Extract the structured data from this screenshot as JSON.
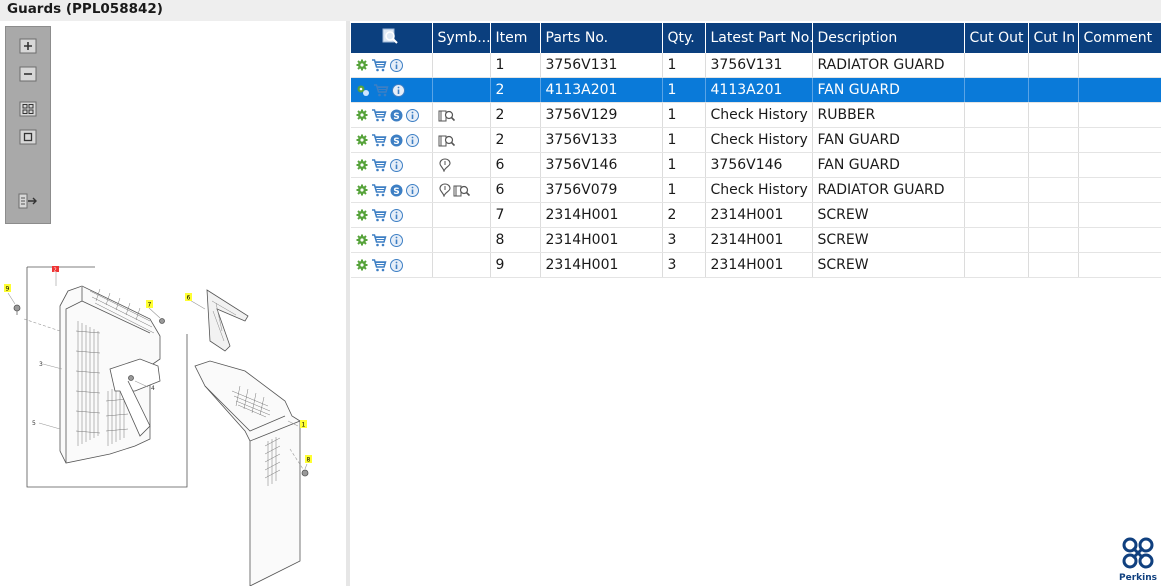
{
  "window": {
    "title": "Guards (PPL058842)"
  },
  "toolbar": {
    "buttons": [
      {
        "name": "zoom-in-button",
        "icon": "zoom-in-icon"
      },
      {
        "name": "zoom-out-button",
        "icon": "zoom-out-icon"
      },
      {
        "name": "fit-window-button",
        "icon": "fit-window-icon"
      },
      {
        "name": "actual-size-button",
        "icon": "actual-size-icon"
      },
      {
        "name": "export-button",
        "icon": "export-icon"
      }
    ]
  },
  "drawing": {
    "callouts": [
      "9",
      "7",
      "6",
      "3",
      "4",
      "5",
      "1",
      "8",
      "2"
    ]
  },
  "table": {
    "columns": [
      "",
      "Symb...",
      "Item",
      "Parts No.",
      "Qty.",
      "Latest Part No.",
      "Description",
      "Cut Out",
      "Cut In",
      "Comment"
    ],
    "rows": [
      {
        "item": "1",
        "part_no": "3756V131",
        "qty": "1",
        "latest": "3756V131",
        "description": "RADIATOR GUARD",
        "cut_out": "",
        "cut_in": "",
        "comment": "",
        "icons": [
          "gear-icon",
          "cart-icon",
          "info-icon"
        ],
        "symbols": [],
        "selected": false
      },
      {
        "item": "2",
        "part_no": "4113A201",
        "qty": "1",
        "latest": "4113A201",
        "description": "FAN GUARD",
        "cut_out": "",
        "cut_in": "",
        "comment": "",
        "icons": [
          "gear-icon",
          "cart-icon",
          "info-icon"
        ],
        "symbols": [],
        "selected": true
      },
      {
        "item": "2",
        "part_no": "3756V129",
        "qty": "1",
        "latest": "Check History",
        "description": "RUBBER",
        "cut_out": "",
        "cut_in": "",
        "comment": "",
        "icons": [
          "gear-icon",
          "cart-icon",
          "s-badge-icon",
          "info-icon"
        ],
        "symbols": [
          "history-icon"
        ],
        "selected": false
      },
      {
        "item": "2",
        "part_no": "3756V133",
        "qty": "1",
        "latest": "Check History",
        "description": "FAN GUARD",
        "cut_out": "",
        "cut_in": "",
        "comment": "",
        "icons": [
          "gear-icon",
          "cart-icon",
          "s-badge-icon",
          "info-icon"
        ],
        "symbols": [
          "history-icon"
        ],
        "selected": false
      },
      {
        "item": "6",
        "part_no": "3756V146",
        "qty": "1",
        "latest": "3756V146",
        "description": "FAN GUARD",
        "cut_out": "",
        "cut_in": "",
        "comment": "",
        "icons": [
          "gear-icon",
          "cart-icon",
          "info-icon"
        ],
        "symbols": [
          "pin-icon"
        ],
        "selected": false
      },
      {
        "item": "6",
        "part_no": "3756V079",
        "qty": "1",
        "latest": "Check History",
        "description": "RADIATOR GUARD",
        "cut_out": "",
        "cut_in": "",
        "comment": "",
        "icons": [
          "gear-icon",
          "cart-icon",
          "s-badge-icon",
          "info-icon"
        ],
        "symbols": [
          "pin-icon",
          "history-icon"
        ],
        "selected": false
      },
      {
        "item": "7",
        "part_no": "2314H001",
        "qty": "2",
        "latest": "2314H001",
        "description": "SCREW",
        "cut_out": "",
        "cut_in": "",
        "comment": "",
        "icons": [
          "gear-icon",
          "cart-icon",
          "info-icon"
        ],
        "symbols": [],
        "selected": false
      },
      {
        "item": "8",
        "part_no": "2314H001",
        "qty": "3",
        "latest": "2314H001",
        "description": "SCREW",
        "cut_out": "",
        "cut_in": "",
        "comment": "",
        "icons": [
          "gear-icon",
          "cart-icon",
          "info-icon"
        ],
        "symbols": [],
        "selected": false
      },
      {
        "item": "9",
        "part_no": "2314H001",
        "qty": "3",
        "latest": "2314H001",
        "description": "SCREW",
        "cut_out": "",
        "cut_in": "",
        "comment": "",
        "icons": [
          "gear-icon",
          "cart-icon",
          "info-icon"
        ],
        "symbols": [],
        "selected": false
      }
    ]
  },
  "brand": {
    "name": "Perkins",
    "color": "#10407f"
  },
  "colors": {
    "header": "#0b3f7e",
    "selection": "#0a7ad9",
    "toolbox": "#a9a9a9"
  }
}
